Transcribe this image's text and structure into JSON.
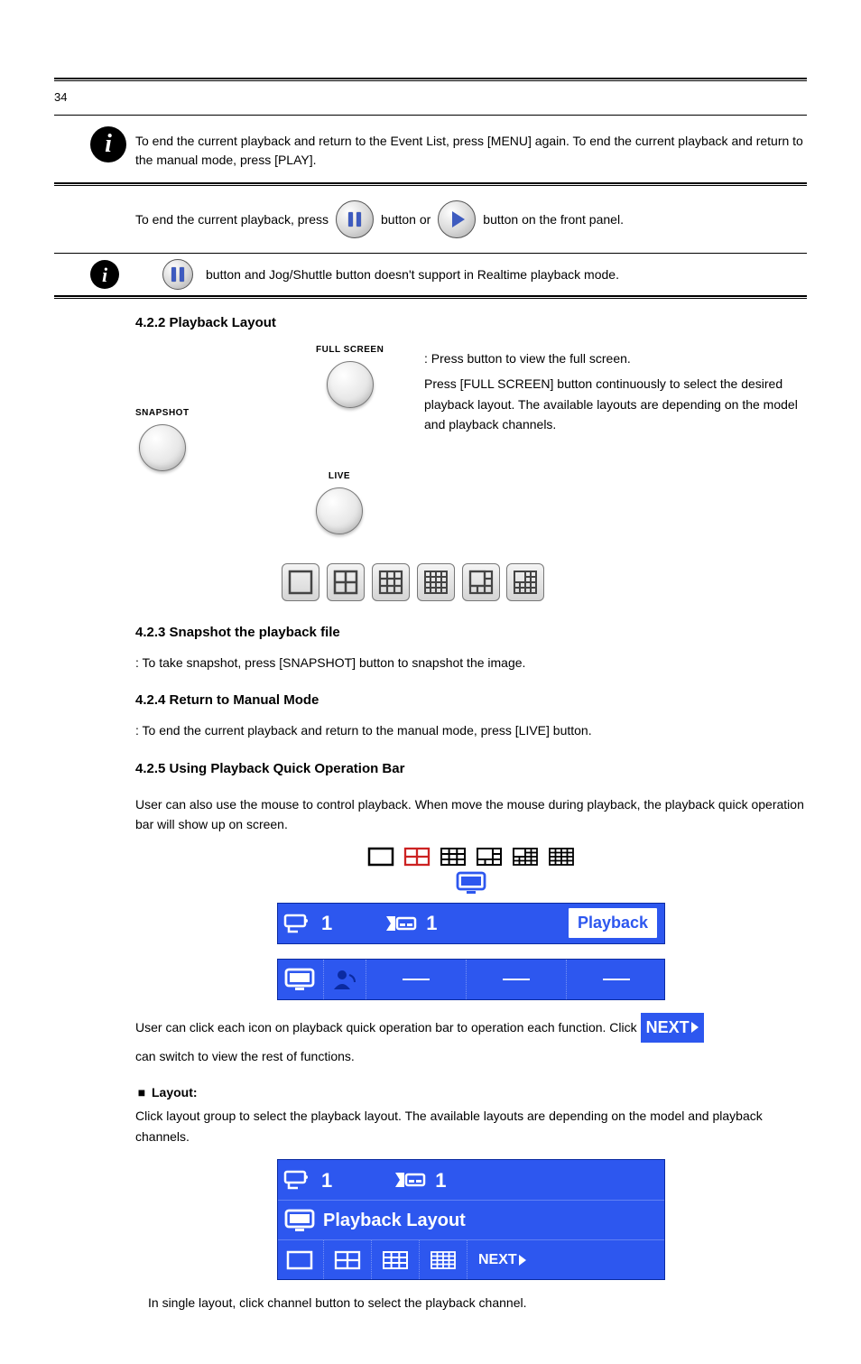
{
  "page_number": "34",
  "notes": {
    "eventlist_to_manual": "To end the current playback and return to the Event List, press [MENU] again. To end the current playback and return to the manual mode, press [PLAY].",
    "end_current_playback_line": "To end the current playback, press         button or         button on the front panel.",
    "pause_not_supported": "button and Jog/Shuttle button doesn't support in Realtime playback mode."
  },
  "buttons": {
    "full_screen_label": "FULL SCREEN",
    "snapshot_label": "SNAPSHOT",
    "live_label": "LIVE",
    "full_screen_desc": ": Press         button to view the full screen.",
    "playback_desc": "Press [FULL SCREEN] button continuously to select the desired playback layout. The available layouts are depending on the model and playback channels."
  },
  "sections": {
    "playback_layout_title": "4.2.2 Playback Layout",
    "snapshot_title": "4.2.3 Snapshot the playback file",
    "snapshot_desc": ": To take snapshot, press [SNAPSHOT] button to snapshot the image.",
    "live_title": "4.2.4 Return to Manual Mode",
    "live_desc": ": To end the current playback and return to the manual mode, press [LIVE] button.",
    "quick_title": "4.2.5 Using Playback Quick Operation Bar",
    "quick_para1": "User can also use the mouse to control playback. When move the mouse during playback, the playback quick operation bar will show up on screen.",
    "quick_para2_part1": "User can click each icon on playback quick operation bar to operation each function. Click",
    "quick_para2_part2": "can switch to view the rest of functions.",
    "layout_group_label": "Layout:",
    "layout_group_desc": "Click layout group to select the playback layout. The available layouts are depending on the model and playback channels.",
    "layout_channel_desc": "In single layout, click channel button to select the playback channel.",
    "next_label": "NEXT",
    "playback_btn": "Playback",
    "playback_layout_caption": "Playback Layout",
    "cam_num": "1",
    "hdd_num": "1"
  }
}
